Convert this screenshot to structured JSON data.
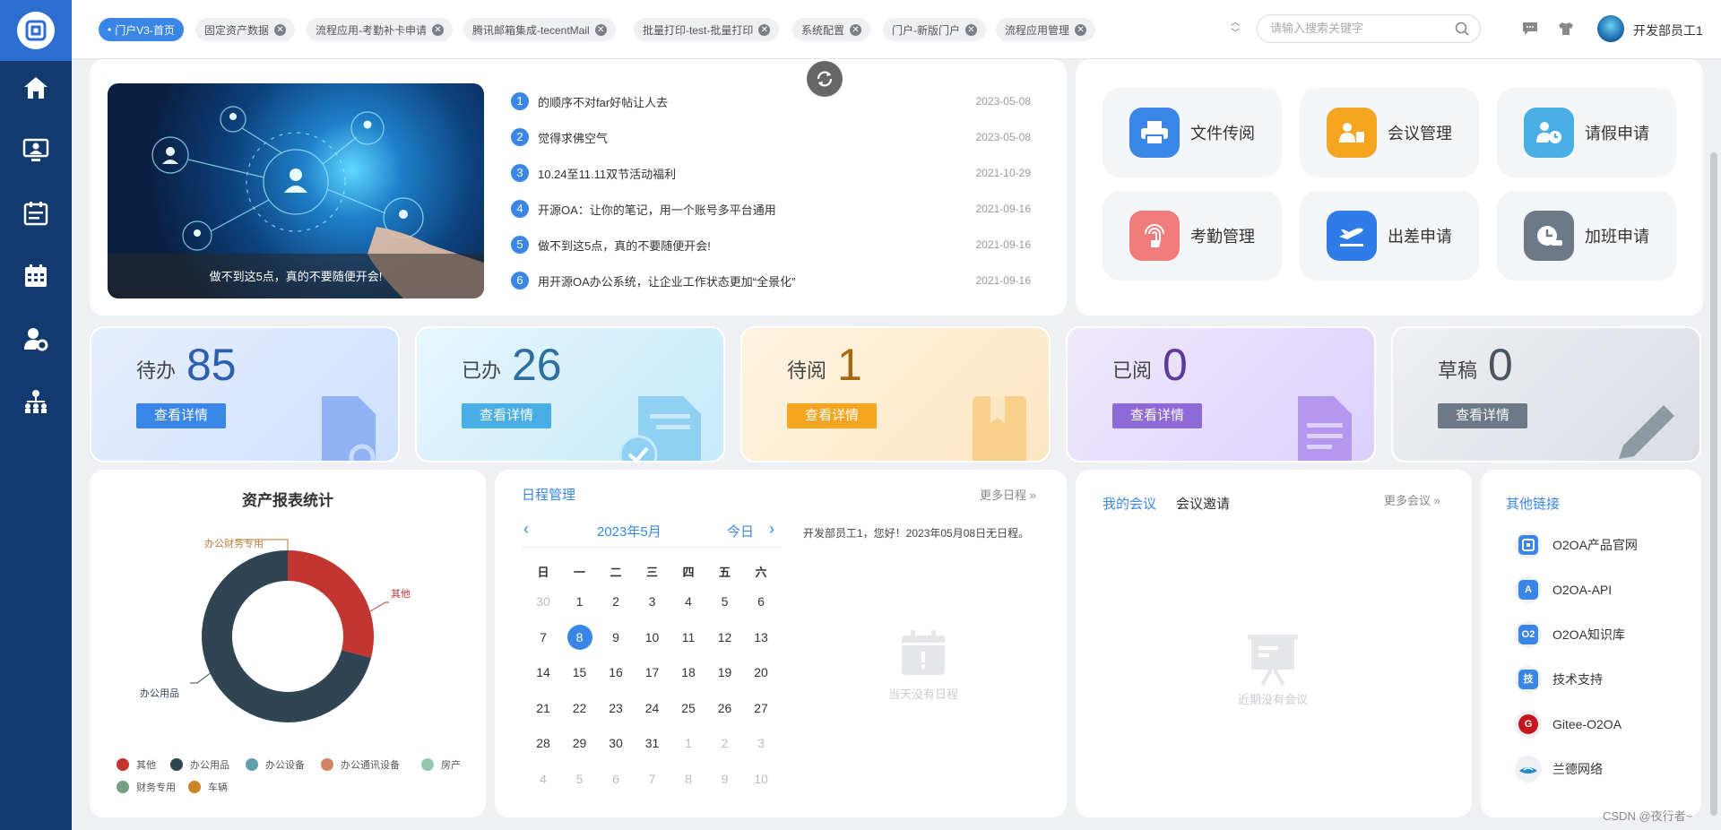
{
  "tabs": [
    {
      "label": "门户V3-首页",
      "active": true
    },
    {
      "label": "固定资产数据"
    },
    {
      "label": "流程应用-考勤补卡申请"
    },
    {
      "label": "腾讯邮箱集成-tecentMail"
    },
    {
      "label": "批量打印-test-批量打印"
    },
    {
      "label": "系统配置"
    },
    {
      "label": "门户-新版门户"
    },
    {
      "label": "流程应用管理"
    }
  ],
  "search": {
    "placeholder": "请输入搜索关键字"
  },
  "user": {
    "name": "开发部员工1"
  },
  "banner": {
    "caption": "做不到这5点，真的不要随便开会!"
  },
  "news": [
    {
      "num": "1",
      "title": "的顺序不对far好帖让人去",
      "date": "2023-05-08"
    },
    {
      "num": "2",
      "title": "觉得求佛空气",
      "date": "2023-05-08"
    },
    {
      "num": "3",
      "title": "10.24至11.11双节活动福利",
      "date": "2021-10-29"
    },
    {
      "num": "4",
      "title": "开源OA：让你的笔记，用一个账号多平台通用",
      "date": "2021-09-16"
    },
    {
      "num": "5",
      "title": "做不到这5点，真的不要随便开会!",
      "date": "2021-09-16"
    },
    {
      "num": "6",
      "title": "用开源OA办公系统，让企业工作状态更加“全景化”",
      "date": "2021-09-16"
    }
  ],
  "quick_apps": [
    {
      "label": "文件传阅",
      "icon": "printer-icon",
      "color": "#3a86e6"
    },
    {
      "label": "会议管理",
      "icon": "meeting-icon",
      "color": "#f3a520"
    },
    {
      "label": "请假申请",
      "icon": "leave-clock-icon",
      "color": "#4aaee6"
    },
    {
      "label": "考勤管理",
      "icon": "fingerprint-icon",
      "color": "#f27c7c"
    },
    {
      "label": "出差申请",
      "icon": "airplane-icon",
      "color": "#2f7be8"
    },
    {
      "label": "加班申请",
      "icon": "overtime-clock-icon",
      "color": "#6b7a86"
    }
  ],
  "stats": [
    {
      "label": "待办",
      "value": "85",
      "button": "查看详情",
      "color": "#2d5fb0",
      "btn": "#3a86e6"
    },
    {
      "label": "已办",
      "value": "26",
      "button": "查看详情",
      "color": "#2e6f9f",
      "btn": "#4aaee6"
    },
    {
      "label": "待阅",
      "value": "1",
      "button": "查看详情",
      "color": "#a06a10",
      "btn": "#f3a520"
    },
    {
      "label": "已阅",
      "value": "0",
      "button": "查看详情",
      "color": "#5a3a9a",
      "btn": "#8e6ad8"
    },
    {
      "label": "草稿",
      "value": "0",
      "button": "查看详情",
      "color": "#4a5560",
      "btn": "#6b7a86"
    }
  ],
  "asset_chart": {
    "title": "资产报表统计",
    "chart_data": {
      "type": "pie",
      "title": "资产报表统计",
      "slices": [
        {
          "name": "其他",
          "value": 29,
          "color": "#c23531"
        },
        {
          "name": "办公用品",
          "value": 71,
          "color": "#2f4554"
        },
        {
          "name": "办公设备",
          "value": 0,
          "color": "#61a0a8"
        },
        {
          "name": "办公通讯设备",
          "value": 0,
          "color": "#d48265"
        },
        {
          "name": "房产",
          "value": 0,
          "color": "#91c7ae"
        },
        {
          "name": "财务专用",
          "value": 0,
          "color": "#749f83"
        },
        {
          "name": "车辆",
          "value": 0,
          "color": "#ca8622"
        }
      ],
      "legend": "bottom"
    },
    "overlap_label": "办公财务专用"
  },
  "schedule": {
    "title": "日程管理",
    "more": "更多日程",
    "month": "2023年5月",
    "today": "今日",
    "weekdays": [
      "日",
      "一",
      "二",
      "三",
      "四",
      "五",
      "六"
    ],
    "weeks": [
      [
        "30",
        "1",
        "2",
        "3",
        "4",
        "5",
        "6"
      ],
      [
        "7",
        "8",
        "9",
        "10",
        "11",
        "12",
        "13"
      ],
      [
        "14",
        "15",
        "16",
        "17",
        "18",
        "19",
        "20"
      ],
      [
        "21",
        "22",
        "23",
        "24",
        "25",
        "26",
        "27"
      ],
      [
        "28",
        "29",
        "30",
        "31",
        "1",
        "2",
        "3"
      ],
      [
        "4",
        "5",
        "6",
        "7",
        "8",
        "9",
        "10"
      ]
    ],
    "selected": "8",
    "greeting": "开发部员工1，您好！2023年05月08日无日程。",
    "empty": "当天没有日程"
  },
  "meetings": {
    "tab_mine": "我的会议",
    "tab_invite": "会议邀请",
    "more": "更多会议",
    "empty": "近期没有会议"
  },
  "links": {
    "title": "其他链接",
    "items": [
      {
        "label": "O2OA产品官网",
        "badge": "",
        "color": "#3a86e6"
      },
      {
        "label": "O2OA-API",
        "badge": "A",
        "color": "#3a86e6"
      },
      {
        "label": "O2OA知识库",
        "badge": "O2",
        "color": "#3a86e6"
      },
      {
        "label": "技术支持",
        "badge": "技",
        "color": "#3a86e6"
      },
      {
        "label": "Gitee-O2OA",
        "badge": "G",
        "color": "#c7161d"
      },
      {
        "label": "兰德网络",
        "badge": "",
        "color": "#1e8acb"
      }
    ]
  },
  "watermark": "CSDN @夜行者~"
}
